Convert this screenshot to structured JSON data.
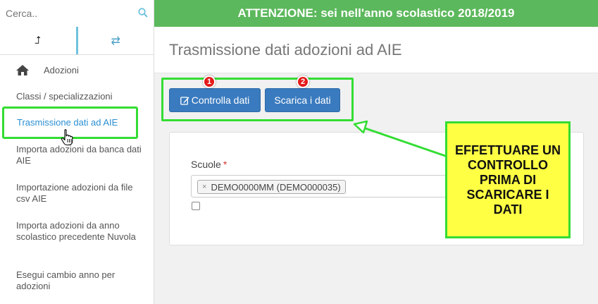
{
  "search": {
    "placeholder": "Cerca.."
  },
  "sidebar": {
    "toggle_left_glyph": "⮥",
    "toggle_right_glyph": "⇄",
    "home_label": "Adozioni",
    "items": [
      {
        "label": "Classi / specializzazioni"
      },
      {
        "label": "Trasmissione dati ad AIE"
      },
      {
        "label": "Importa adozioni da banca dati AIE"
      },
      {
        "label": "Importazione adozioni da file csv AIE"
      },
      {
        "label": "Importa adozioni da anno scolastico precedente Nuvola"
      },
      {
        "label": "Esegui cambio anno per adozioni"
      }
    ]
  },
  "banner": {
    "text": "ATTENZIONE: sei nell'anno scolastico 2018/2019"
  },
  "header": {
    "title": "Trasmissione dati adozioni ad AIE"
  },
  "toolbar": {
    "check_label": "Controlla dati",
    "download_label": "Scarica i dati",
    "badge1": "1",
    "badge2": "2"
  },
  "form": {
    "field_label": "Scuole",
    "required_mark": "*",
    "selected_chip": "DEMO0000MM (DEMO000035)",
    "chip_remove": "×"
  },
  "callout": {
    "text": "EFFETTUARE UN CONTROLLO PRIMA DI SCARICARE I DATI"
  },
  "colors": {
    "banner": "#5cb85c",
    "button": "#3a7bbf",
    "highlight": "#33dd33",
    "callout_bg": "#ffff44",
    "active_link": "#2a8fd2",
    "badge": "#e41a1a"
  }
}
